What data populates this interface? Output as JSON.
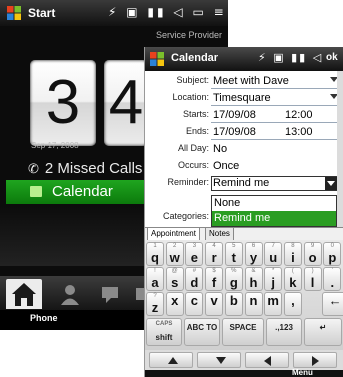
{
  "home": {
    "title": "Start",
    "status_icons": "⚡ ▣ ▮▮ ◁ ▭ ≡",
    "provider": "Service Provider",
    "clock_hour": "3",
    "clock_min": "4",
    "date": "Sep 17, 2008",
    "missed_calls": "2 Missed Calls",
    "calendar_label": "Calendar",
    "phone_label": "Phone",
    "icons": [
      "start-icon",
      "phone-icon",
      "house-icon",
      "contacts-icon",
      "messages-icon"
    ]
  },
  "cal": {
    "title": "Calendar",
    "status_icons": "⚡ ▣ ▮▮ ◁",
    "ok": "ok",
    "fields": {
      "subject_label": "Subject:",
      "subject_value": "Meet with Dave",
      "location_label": "Location:",
      "location_value": "Timesquare",
      "starts_label": "Starts:",
      "starts_date": "17/09/08",
      "starts_time": "12:00",
      "ends_label": "Ends:",
      "ends_date": "17/09/08",
      "ends_time": "13:00",
      "allday_label": "All Day:",
      "allday_value": "No",
      "occurs_label": "Occurs:",
      "occurs_value": "Once",
      "reminder_label": "Reminder:",
      "reminder_value": "Remind me",
      "categories_label": "Categories:"
    },
    "dropdown": [
      "None",
      "Remind me"
    ],
    "tabs": [
      "Appointment",
      "Notes"
    ],
    "keyboard": {
      "row1": [
        {
          "alt": "1",
          "main": "q"
        },
        {
          "alt": "2",
          "main": "w"
        },
        {
          "alt": "3",
          "main": "e"
        },
        {
          "alt": "4",
          "main": "r"
        },
        {
          "alt": "5",
          "main": "t"
        },
        {
          "alt": "6",
          "main": "y"
        },
        {
          "alt": "7",
          "main": "u"
        },
        {
          "alt": "8",
          "main": "i"
        },
        {
          "alt": "9",
          "main": "o"
        },
        {
          "alt": "0",
          "main": "p"
        }
      ],
      "row2": [
        {
          "alt": "!",
          "main": "a"
        },
        {
          "alt": "@",
          "main": "s"
        },
        {
          "alt": "#",
          "main": "d"
        },
        {
          "alt": "$",
          "main": "f"
        },
        {
          "alt": "%",
          "main": "g"
        },
        {
          "alt": "&",
          "main": "h"
        },
        {
          "alt": "*",
          "main": "j"
        },
        {
          "alt": "(",
          "main": "k"
        },
        {
          "alt": ")",
          "main": "l"
        },
        {
          "alt": "'",
          "main": "."
        }
      ],
      "row3": [
        {
          "alt": "?",
          "main": "z"
        },
        {
          "alt": "",
          "main": "x"
        },
        {
          "alt": "",
          "main": "c"
        },
        {
          "alt": "",
          "main": "v"
        },
        {
          "alt": "",
          "main": "b"
        },
        {
          "alt": "",
          "main": "n"
        },
        {
          "alt": "",
          "main": "m"
        },
        {
          "alt": "",
          "main": ","
        },
        {
          "alt": "",
          "main": "←"
        }
      ],
      "caps": "CAPS",
      "shift": "shift",
      "abc": "ABC",
      "to": "TO",
      "space": "SPACE",
      "num": ".,123",
      "enter": "↵"
    },
    "menu": "Menu"
  }
}
